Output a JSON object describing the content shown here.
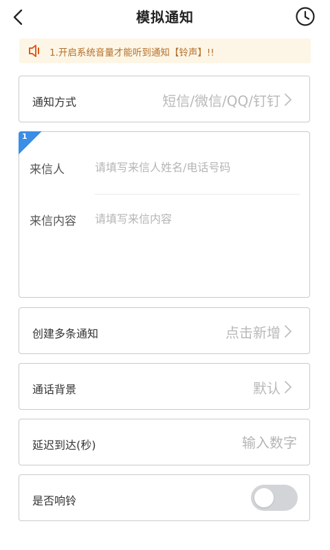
{
  "header": {
    "title": "模拟通知",
    "back_icon": "chevron-left-icon",
    "history_icon": "clock-icon"
  },
  "notice": {
    "icon": "speaker-icon",
    "text": "1.开启系统音量才能听到通知【铃声】!!",
    "bg_color": "#fdf6e6",
    "text_color": "#b46f2a"
  },
  "notify_method": {
    "label": "通知方式",
    "value": "短信/微信/QQ/钉钉"
  },
  "message": {
    "index": "1",
    "accent_color": "#3a8ee6",
    "sender_label": "来信人",
    "sender_placeholder": "请填写来信人姓名/电话号码",
    "content_label": "来信内容",
    "content_placeholder": "请填写来信内容"
  },
  "multi": {
    "label": "创建多条通知",
    "value": "点击新增"
  },
  "background": {
    "label": "通话背景",
    "value": "默认"
  },
  "delay": {
    "label": "延迟到达(秒)",
    "placeholder": "输入数字"
  },
  "ring": {
    "label": "是否响铃",
    "enabled": false
  }
}
